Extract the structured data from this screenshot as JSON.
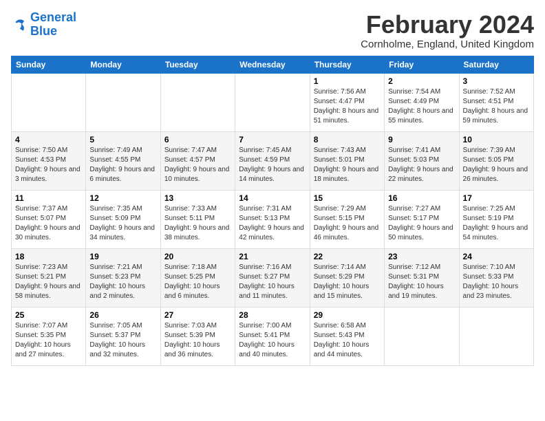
{
  "logo": {
    "line1": "General",
    "line2": "Blue"
  },
  "title": "February 2024",
  "subtitle": "Cornholme, England, United Kingdom",
  "days_of_week": [
    "Sunday",
    "Monday",
    "Tuesday",
    "Wednesday",
    "Thursday",
    "Friday",
    "Saturday"
  ],
  "weeks": [
    [
      {
        "day": "",
        "content": ""
      },
      {
        "day": "",
        "content": ""
      },
      {
        "day": "",
        "content": ""
      },
      {
        "day": "",
        "content": ""
      },
      {
        "day": "1",
        "content": "Sunrise: 7:56 AM\nSunset: 4:47 PM\nDaylight: 8 hours and 51 minutes."
      },
      {
        "day": "2",
        "content": "Sunrise: 7:54 AM\nSunset: 4:49 PM\nDaylight: 8 hours and 55 minutes."
      },
      {
        "day": "3",
        "content": "Sunrise: 7:52 AM\nSunset: 4:51 PM\nDaylight: 8 hours and 59 minutes."
      }
    ],
    [
      {
        "day": "4",
        "content": "Sunrise: 7:50 AM\nSunset: 4:53 PM\nDaylight: 9 hours and 3 minutes."
      },
      {
        "day": "5",
        "content": "Sunrise: 7:49 AM\nSunset: 4:55 PM\nDaylight: 9 hours and 6 minutes."
      },
      {
        "day": "6",
        "content": "Sunrise: 7:47 AM\nSunset: 4:57 PM\nDaylight: 9 hours and 10 minutes."
      },
      {
        "day": "7",
        "content": "Sunrise: 7:45 AM\nSunset: 4:59 PM\nDaylight: 9 hours and 14 minutes."
      },
      {
        "day": "8",
        "content": "Sunrise: 7:43 AM\nSunset: 5:01 PM\nDaylight: 9 hours and 18 minutes."
      },
      {
        "day": "9",
        "content": "Sunrise: 7:41 AM\nSunset: 5:03 PM\nDaylight: 9 hours and 22 minutes."
      },
      {
        "day": "10",
        "content": "Sunrise: 7:39 AM\nSunset: 5:05 PM\nDaylight: 9 hours and 26 minutes."
      }
    ],
    [
      {
        "day": "11",
        "content": "Sunrise: 7:37 AM\nSunset: 5:07 PM\nDaylight: 9 hours and 30 minutes."
      },
      {
        "day": "12",
        "content": "Sunrise: 7:35 AM\nSunset: 5:09 PM\nDaylight: 9 hours and 34 minutes."
      },
      {
        "day": "13",
        "content": "Sunrise: 7:33 AM\nSunset: 5:11 PM\nDaylight: 9 hours and 38 minutes."
      },
      {
        "day": "14",
        "content": "Sunrise: 7:31 AM\nSunset: 5:13 PM\nDaylight: 9 hours and 42 minutes."
      },
      {
        "day": "15",
        "content": "Sunrise: 7:29 AM\nSunset: 5:15 PM\nDaylight: 9 hours and 46 minutes."
      },
      {
        "day": "16",
        "content": "Sunrise: 7:27 AM\nSunset: 5:17 PM\nDaylight: 9 hours and 50 minutes."
      },
      {
        "day": "17",
        "content": "Sunrise: 7:25 AM\nSunset: 5:19 PM\nDaylight: 9 hours and 54 minutes."
      }
    ],
    [
      {
        "day": "18",
        "content": "Sunrise: 7:23 AM\nSunset: 5:21 PM\nDaylight: 9 hours and 58 minutes."
      },
      {
        "day": "19",
        "content": "Sunrise: 7:21 AM\nSunset: 5:23 PM\nDaylight: 10 hours and 2 minutes."
      },
      {
        "day": "20",
        "content": "Sunrise: 7:18 AM\nSunset: 5:25 PM\nDaylight: 10 hours and 6 minutes."
      },
      {
        "day": "21",
        "content": "Sunrise: 7:16 AM\nSunset: 5:27 PM\nDaylight: 10 hours and 11 minutes."
      },
      {
        "day": "22",
        "content": "Sunrise: 7:14 AM\nSunset: 5:29 PM\nDaylight: 10 hours and 15 minutes."
      },
      {
        "day": "23",
        "content": "Sunrise: 7:12 AM\nSunset: 5:31 PM\nDaylight: 10 hours and 19 minutes."
      },
      {
        "day": "24",
        "content": "Sunrise: 7:10 AM\nSunset: 5:33 PM\nDaylight: 10 hours and 23 minutes."
      }
    ],
    [
      {
        "day": "25",
        "content": "Sunrise: 7:07 AM\nSunset: 5:35 PM\nDaylight: 10 hours and 27 minutes."
      },
      {
        "day": "26",
        "content": "Sunrise: 7:05 AM\nSunset: 5:37 PM\nDaylight: 10 hours and 32 minutes."
      },
      {
        "day": "27",
        "content": "Sunrise: 7:03 AM\nSunset: 5:39 PM\nDaylight: 10 hours and 36 minutes."
      },
      {
        "day": "28",
        "content": "Sunrise: 7:00 AM\nSunset: 5:41 PM\nDaylight: 10 hours and 40 minutes."
      },
      {
        "day": "29",
        "content": "Sunrise: 6:58 AM\nSunset: 5:43 PM\nDaylight: 10 hours and 44 minutes."
      },
      {
        "day": "",
        "content": ""
      },
      {
        "day": "",
        "content": ""
      }
    ]
  ]
}
